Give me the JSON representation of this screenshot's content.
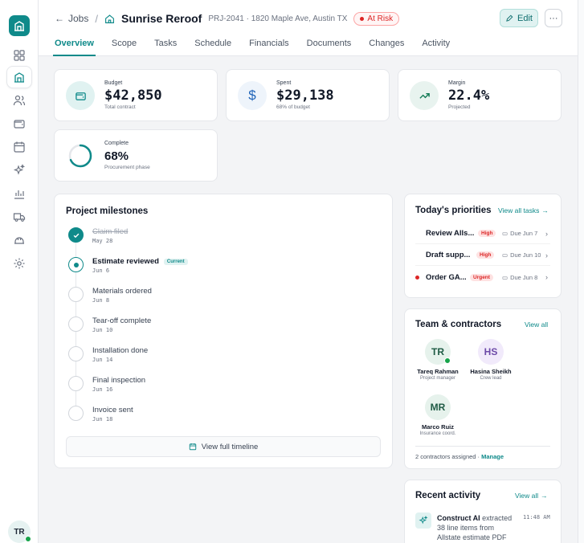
{
  "nav": {
    "back_label": "Jobs",
    "project_title": "Sunrise Reroof",
    "project_sub": "PRJ-2041 · 1820 Maple Ave, Austin TX",
    "status_badge": "At Risk",
    "edit_label": "Edit",
    "more_label": "···"
  },
  "tabs": [
    "Overview",
    "Scope",
    "Tasks",
    "Schedule",
    "Financials",
    "Documents",
    "Changes",
    "Activity"
  ],
  "stats": {
    "budget": {
      "label": "Budget",
      "value": "$42,850",
      "sub": "Total contract"
    },
    "spent": {
      "label": "Spent",
      "value": "$29,138",
      "sub": "68% of budget"
    },
    "margin": {
      "label": "Margin",
      "value": "22.4%",
      "sub": "Projected"
    },
    "complete": {
      "label": "Complete",
      "value": "68%",
      "sub": "Procurement phase",
      "progress": 0.68
    }
  },
  "milestones": {
    "title": "Project milestones",
    "current_badge": "Current",
    "items": [
      {
        "name": "Claim filed",
        "date": "May 28",
        "state": "done"
      },
      {
        "name": "Estimate reviewed",
        "date": "Jun 6",
        "state": "current"
      },
      {
        "name": "Materials ordered",
        "date": "Jun 8",
        "state": "pending"
      },
      {
        "name": "Tear-off complete",
        "date": "Jun 10",
        "state": "pending"
      },
      {
        "name": "Installation done",
        "date": "Jun 14",
        "state": "pending"
      },
      {
        "name": "Final inspection",
        "date": "Jun 16",
        "state": "pending"
      },
      {
        "name": "Invoice sent",
        "date": "Jun 18",
        "state": "pending"
      }
    ],
    "timeline_button": "View full timeline"
  },
  "priorities": {
    "title": "Today's priorities",
    "link": "View all tasks",
    "items": [
      {
        "name": "Review Alls...",
        "badge": "High",
        "due": "Due Jun 7",
        "dot": false
      },
      {
        "name": "Draft supp...",
        "badge": "High",
        "due": "Due Jun 10",
        "dot": false
      },
      {
        "name": "Order GA...",
        "badge": "Urgent",
        "due": "Due Jun 8",
        "dot": true
      }
    ]
  },
  "team": {
    "title": "Team & contractors",
    "link": "View all",
    "members": [
      {
        "initials": "TR",
        "name": "Tareq Rahman",
        "role": "Project manager",
        "online": true
      },
      {
        "initials": "HS",
        "name": "Hasina Sheikh",
        "role": "Crew lead",
        "online": false
      },
      {
        "initials": "MR",
        "name": "Marco Ruiz",
        "role": "Insurance coord.",
        "online": false
      }
    ],
    "footer_text": "2 contractors assigned · ",
    "footer_link": "Manage"
  },
  "activity": {
    "title": "Recent activity",
    "link": "View all",
    "items": [
      {
        "actor": "Construct AI",
        "text": " extracted 38 line items from Allstate estimate PDF",
        "time": "11:48 AM"
      }
    ]
  },
  "user": {
    "initials": "TR"
  },
  "colors": {
    "accent": "#0f8a8a",
    "danger": "#dc2626",
    "online": "#16a34a"
  }
}
